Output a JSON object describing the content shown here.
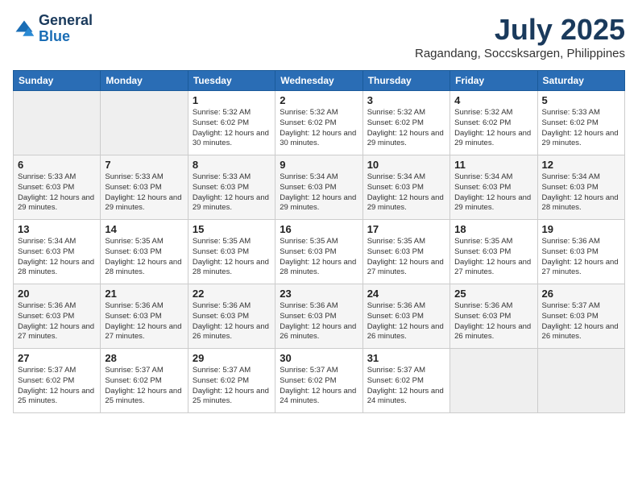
{
  "header": {
    "logo_line1": "General",
    "logo_line2": "Blue",
    "month": "July 2025",
    "location": "Ragandang, Soccsksargen, Philippines"
  },
  "weekdays": [
    "Sunday",
    "Monday",
    "Tuesday",
    "Wednesday",
    "Thursday",
    "Friday",
    "Saturday"
  ],
  "weeks": [
    [
      {
        "day": "",
        "empty": true
      },
      {
        "day": "",
        "empty": true
      },
      {
        "day": "1",
        "sunrise": "5:32 AM",
        "sunset": "6:02 PM",
        "daylight": "12 hours and 30 minutes."
      },
      {
        "day": "2",
        "sunrise": "5:32 AM",
        "sunset": "6:02 PM",
        "daylight": "12 hours and 30 minutes."
      },
      {
        "day": "3",
        "sunrise": "5:32 AM",
        "sunset": "6:02 PM",
        "daylight": "12 hours and 29 minutes."
      },
      {
        "day": "4",
        "sunrise": "5:32 AM",
        "sunset": "6:02 PM",
        "daylight": "12 hours and 29 minutes."
      },
      {
        "day": "5",
        "sunrise": "5:33 AM",
        "sunset": "6:02 PM",
        "daylight": "12 hours and 29 minutes."
      }
    ],
    [
      {
        "day": "6",
        "sunrise": "5:33 AM",
        "sunset": "6:03 PM",
        "daylight": "12 hours and 29 minutes."
      },
      {
        "day": "7",
        "sunrise": "5:33 AM",
        "sunset": "6:03 PM",
        "daylight": "12 hours and 29 minutes."
      },
      {
        "day": "8",
        "sunrise": "5:33 AM",
        "sunset": "6:03 PM",
        "daylight": "12 hours and 29 minutes."
      },
      {
        "day": "9",
        "sunrise": "5:34 AM",
        "sunset": "6:03 PM",
        "daylight": "12 hours and 29 minutes."
      },
      {
        "day": "10",
        "sunrise": "5:34 AM",
        "sunset": "6:03 PM",
        "daylight": "12 hours and 29 minutes."
      },
      {
        "day": "11",
        "sunrise": "5:34 AM",
        "sunset": "6:03 PM",
        "daylight": "12 hours and 29 minutes."
      },
      {
        "day": "12",
        "sunrise": "5:34 AM",
        "sunset": "6:03 PM",
        "daylight": "12 hours and 28 minutes."
      }
    ],
    [
      {
        "day": "13",
        "sunrise": "5:34 AM",
        "sunset": "6:03 PM",
        "daylight": "12 hours and 28 minutes."
      },
      {
        "day": "14",
        "sunrise": "5:35 AM",
        "sunset": "6:03 PM",
        "daylight": "12 hours and 28 minutes."
      },
      {
        "day": "15",
        "sunrise": "5:35 AM",
        "sunset": "6:03 PM",
        "daylight": "12 hours and 28 minutes."
      },
      {
        "day": "16",
        "sunrise": "5:35 AM",
        "sunset": "6:03 PM",
        "daylight": "12 hours and 28 minutes."
      },
      {
        "day": "17",
        "sunrise": "5:35 AM",
        "sunset": "6:03 PM",
        "daylight": "12 hours and 27 minutes."
      },
      {
        "day": "18",
        "sunrise": "5:35 AM",
        "sunset": "6:03 PM",
        "daylight": "12 hours and 27 minutes."
      },
      {
        "day": "19",
        "sunrise": "5:36 AM",
        "sunset": "6:03 PM",
        "daylight": "12 hours and 27 minutes."
      }
    ],
    [
      {
        "day": "20",
        "sunrise": "5:36 AM",
        "sunset": "6:03 PM",
        "daylight": "12 hours and 27 minutes."
      },
      {
        "day": "21",
        "sunrise": "5:36 AM",
        "sunset": "6:03 PM",
        "daylight": "12 hours and 27 minutes."
      },
      {
        "day": "22",
        "sunrise": "5:36 AM",
        "sunset": "6:03 PM",
        "daylight": "12 hours and 26 minutes."
      },
      {
        "day": "23",
        "sunrise": "5:36 AM",
        "sunset": "6:03 PM",
        "daylight": "12 hours and 26 minutes."
      },
      {
        "day": "24",
        "sunrise": "5:36 AM",
        "sunset": "6:03 PM",
        "daylight": "12 hours and 26 minutes."
      },
      {
        "day": "25",
        "sunrise": "5:36 AM",
        "sunset": "6:03 PM",
        "daylight": "12 hours and 26 minutes."
      },
      {
        "day": "26",
        "sunrise": "5:37 AM",
        "sunset": "6:03 PM",
        "daylight": "12 hours and 26 minutes."
      }
    ],
    [
      {
        "day": "27",
        "sunrise": "5:37 AM",
        "sunset": "6:02 PM",
        "daylight": "12 hours and 25 minutes."
      },
      {
        "day": "28",
        "sunrise": "5:37 AM",
        "sunset": "6:02 PM",
        "daylight": "12 hours and 25 minutes."
      },
      {
        "day": "29",
        "sunrise": "5:37 AM",
        "sunset": "6:02 PM",
        "daylight": "12 hours and 25 minutes."
      },
      {
        "day": "30",
        "sunrise": "5:37 AM",
        "sunset": "6:02 PM",
        "daylight": "12 hours and 24 minutes."
      },
      {
        "day": "31",
        "sunrise": "5:37 AM",
        "sunset": "6:02 PM",
        "daylight": "12 hours and 24 minutes."
      },
      {
        "day": "",
        "empty": true
      },
      {
        "day": "",
        "empty": true
      }
    ]
  ],
  "labels": {
    "sunrise_prefix": "Sunrise: ",
    "sunset_prefix": "Sunset: ",
    "daylight_prefix": "Daylight: "
  }
}
